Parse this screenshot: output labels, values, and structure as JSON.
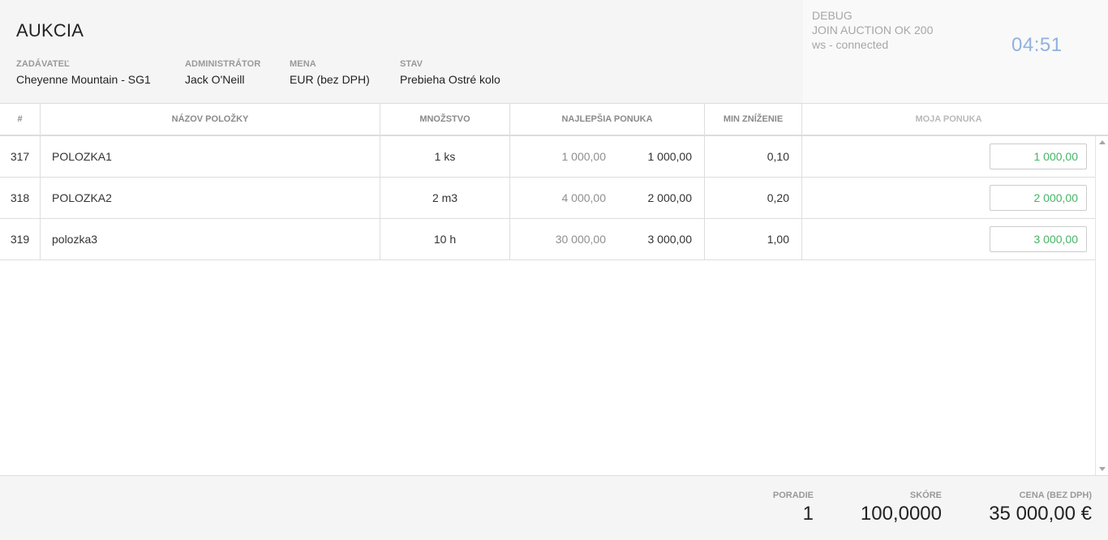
{
  "header": {
    "title": "AUKCIA",
    "meta": [
      {
        "label": "ZADÁVATEĽ",
        "value": "Cheyenne Mountain - SG1"
      },
      {
        "label": "ADMINISTRÁTOR",
        "value": "Jack O'Neill"
      },
      {
        "label": "MENA",
        "value": "EUR (bez DPH)"
      },
      {
        "label": "STAV",
        "value": "Prebieha Ostré kolo"
      }
    ]
  },
  "debug": {
    "lines": [
      "DEBUG",
      "JOIN AUCTION OK 200",
      "ws - connected"
    ],
    "timer": "04:51"
  },
  "table": {
    "columns": [
      "#",
      "NÁZOV POLOŽKY",
      "MNOŽSTVO",
      "NAJLEPŠIA PONUKA",
      "MIN ZNÍŽENIE",
      "MOJA PONUKA"
    ],
    "rows": [
      {
        "id": "317",
        "name": "POLOZKA1",
        "qty": "1 ks",
        "best_a": "1 000,00",
        "best_b": "1 000,00",
        "min": "0,10",
        "bid": "1 000,00"
      },
      {
        "id": "318",
        "name": "POLOZKA2",
        "qty": "2 m3",
        "best_a": "4 000,00",
        "best_b": "2 000,00",
        "min": "0,20",
        "bid": "2 000,00"
      },
      {
        "id": "319",
        "name": "polozka3",
        "qty": "10 h",
        "best_a": "30 000,00",
        "best_b": "3 000,00",
        "min": "1,00",
        "bid": "3 000,00"
      }
    ]
  },
  "footer": {
    "rank": {
      "label": "PORADIE",
      "value": "1"
    },
    "score": {
      "label": "SKÓRE",
      "value": "100,0000"
    },
    "price": {
      "label": "CENA (BEZ DPH)",
      "value": "35 000,00 €"
    }
  },
  "colors": {
    "bid_text": "#45b566",
    "timer": "#8fb2df",
    "header_bg": "#f5f5f5"
  }
}
